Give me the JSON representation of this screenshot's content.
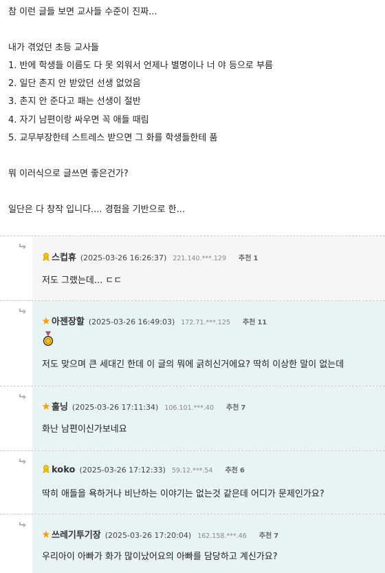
{
  "post": {
    "lines": [
      "참 이런 글들 보면 교사들 수준이 진짜...",
      "",
      "내가 겪었던 초등 교사들",
      "1. 반에 학생들 이름도 다 못 외워서 언제나 별명이나 너 야 등으로 부름",
      "2. 일단 촌지 안 받았던 선생 없었음",
      "3. 촌지 안 준다고 패는 선생이 절반",
      "4. 자기 남편이랑 싸우면 꼭 애들 때림",
      "5. 교무부장한테 스트레스 받으면 그 화를 학생들한테 품",
      "",
      "뭐 이러식으로 글쓰면 좋은건가?",
      "",
      "일단은 다 창작 입니다.... 경험을 기반으로 한..."
    ]
  },
  "comments": [
    {
      "badge_icon": "member-level-icon",
      "nickname": "스컵휴",
      "date": "(2025-03-26 16:26:37)",
      "ip": "221.140.***.129",
      "rec_label": "추천",
      "rec_count": "1",
      "text": "저도 그랬는데... ㄷㄷ",
      "medal": false
    },
    {
      "badge_icon": "star-icon",
      "nickname": "아젠장할",
      "date": "(2025-03-26 16:49:03)",
      "ip": "172.71.***.125",
      "rec_label": "추천",
      "rec_count": "11",
      "text": "저도 맞으며 큰 세대긴 한데 이 글의 뭐에 긁히신거에요? 딱히 이상한 말이 없는데",
      "medal": true
    },
    {
      "badge_icon": "star-icon",
      "nickname": "훌닝",
      "date": "(2025-03-26 17:11:34)",
      "ip": "106.101.***.40",
      "rec_label": "추천",
      "rec_count": "7",
      "text": "화난 남편이신가보네요",
      "medal": false
    },
    {
      "badge_icon": "member-level-icon",
      "nickname": "koko",
      "date": "(2025-03-26 17:12:33)",
      "ip": "59.12.***.54",
      "rec_label": "추천",
      "rec_count": "6",
      "text": "딱히 애들을 욕하거나 비난하는 이야기는 없는것 같은데 어디가 문제인가요?",
      "medal": false
    },
    {
      "badge_icon": "star-icon",
      "nickname": "쓰레기투기장",
      "date": "(2025-03-26 17:20:04)",
      "ip": "162.158.***.46",
      "rec_label": "추천",
      "rec_count": "7",
      "text": "우리아이 아빠가 화가 많이났어요의 아빠를 담당하고 계신가요?",
      "medal": false
    }
  ],
  "colors": {
    "grey_bg": "#f6f6f6",
    "blue_bg": "#e8f3f4",
    "star": "#f5a20a",
    "badge": "#e0b000"
  }
}
